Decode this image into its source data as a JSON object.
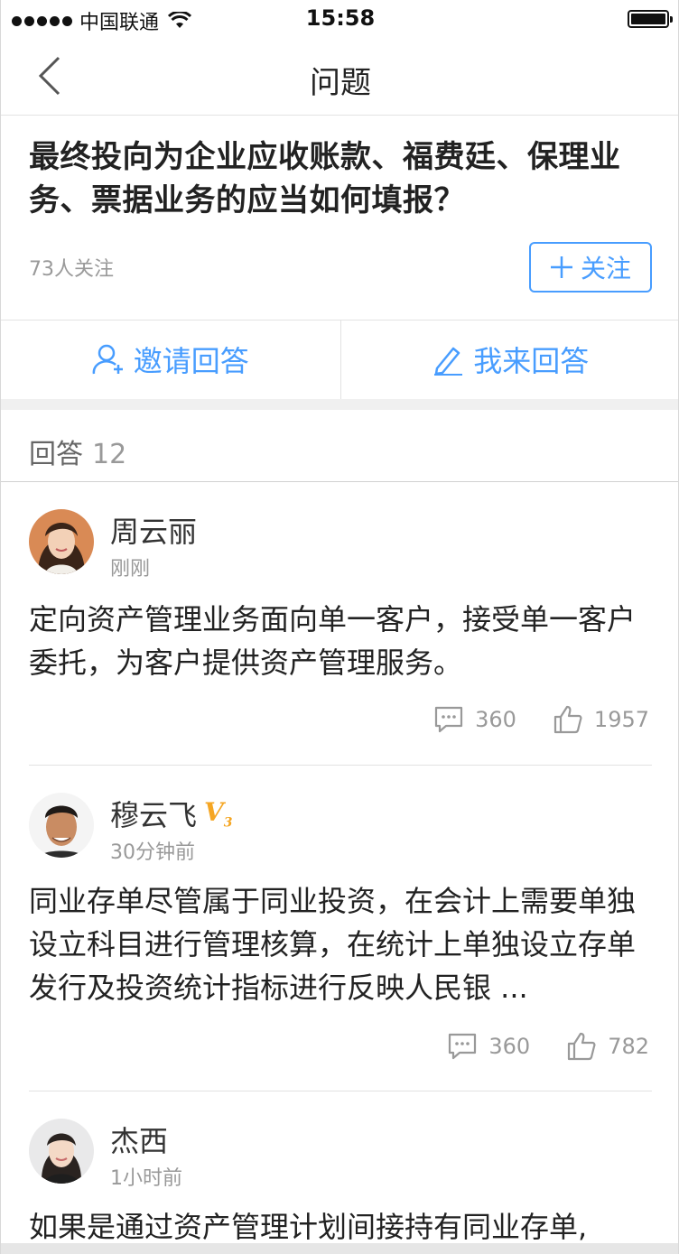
{
  "status_bar": {
    "carrier": "中国联通",
    "time": "15:58"
  },
  "nav": {
    "title": "问题"
  },
  "question": {
    "title": "最终投向为企业应收账款、福费廷、保理业务、票据业务的应当如何填报？",
    "follow_count": "73人关注",
    "follow_button": "关注"
  },
  "actions": {
    "invite": "邀请回答",
    "answer": "我来回答"
  },
  "answers_header": {
    "label": "回答",
    "count": "12"
  },
  "answers": [
    {
      "name": "周云丽",
      "time": "刚刚",
      "body": "定向资产管理业务面向单一客户，接受单一客户委托，为客户提供资产管理服务。",
      "comments": "360",
      "likes": "1957",
      "avatar_icon": "avatar-woman-icon"
    },
    {
      "name": "穆云飞",
      "badge": "V3",
      "time": "30分钟前",
      "body": "同业存单尽管属于同业投资，在会计上需要单独设立科目进行管理核算，在统计上单独设立存单发行及投资统计指标进行反映人民银 ...",
      "comments": "360",
      "likes": "782",
      "avatar_icon": "avatar-man-icon"
    },
    {
      "name": "杰西",
      "time": "1小时前",
      "body": "如果是通过资产管理计划间接持有同业存单,",
      "avatar_icon": "avatar-woman-icon"
    }
  ],
  "colors": {
    "accent": "#489dff",
    "divider": "#e2e2e2",
    "text_primary": "#222222",
    "text_secondary": "#999999",
    "name": "#333333"
  }
}
